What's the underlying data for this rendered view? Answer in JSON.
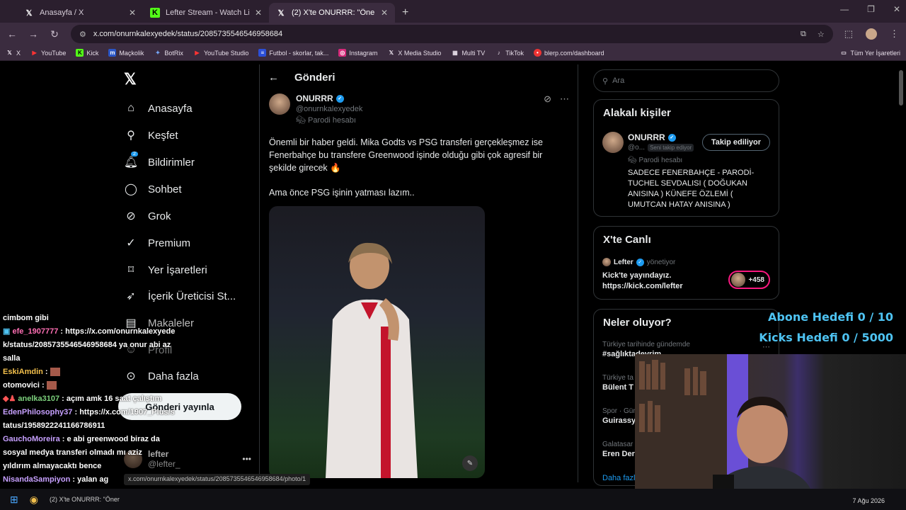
{
  "browser": {
    "tabs": [
      {
        "label": "Anasayfa / X",
        "icon": "x-logo-icon",
        "active": false
      },
      {
        "label": "Lefter Stream - Watch Live on K",
        "icon": "kick-logo-icon",
        "active": false
      },
      {
        "label": "(2) X'te ONURRR: \"Önemli bir ha",
        "icon": "x-logo-icon",
        "active": true
      }
    ],
    "url": "x.com/onurnkalexyedek/status/2085735546546958684",
    "bookmarks": [
      "X",
      "YouTube",
      "Kick",
      "Maçkolik",
      "BotRix",
      "YouTube Studio",
      "Futbol - skorlar, tak...",
      "Instagram",
      "X Media Studio",
      "Multi TV",
      "TikTok",
      "blerp.com/dashboard"
    ],
    "bookmarks_folder": "Tüm Yer İşaretleri"
  },
  "nav": {
    "items": [
      {
        "label": "Anasayfa",
        "icon": "home-icon"
      },
      {
        "label": "Keşfet",
        "icon": "search-icon"
      },
      {
        "label": "Bildirimler",
        "icon": "bell-icon",
        "badge": "2"
      },
      {
        "label": "Sohbet",
        "icon": "chat-icon"
      },
      {
        "label": "Grok",
        "icon": "grok-icon"
      },
      {
        "label": "Premium",
        "icon": "premium-icon"
      },
      {
        "label": "Yer İşaretleri",
        "icon": "bookmark-icon"
      },
      {
        "label": "İçerik Üreticisi St...",
        "icon": "rocket-icon"
      },
      {
        "label": "Makaleler",
        "icon": "article-icon"
      },
      {
        "label": "Profil",
        "icon": "profile-icon"
      },
      {
        "label": "Daha fazla",
        "icon": "more-circle-icon"
      }
    ],
    "post_button": "Gönderi yayınla",
    "account_name": "lefter",
    "account_handle": "@lefter_"
  },
  "post": {
    "header": "Gönderi",
    "author_name": "ONURRR",
    "author_handle": "@onurnkalexyedek",
    "parody": "Parodi hesabı",
    "text1": "Önemli bir haber geldi. Mika Godts vs PSG transferi gerçekleşmez ise Fenerbahçe bu transfere Greenwood işinde olduğu gibi çok agresif bir şekilde girecek 🔥",
    "text2": "Ama önce PSG işinin yatması lazım.."
  },
  "right": {
    "search_placeholder": "Ara",
    "related_title": "Alakalı kişiler",
    "related_name": "ONURRR",
    "related_handle": "@o...",
    "follows_you": "Seni takip ediyor",
    "following_btn": "Takip ediliyor",
    "related_parody": "Parodi hesabı",
    "related_bio": "SADECE FENERBAHÇE - PARODİ- TUCHEL SEVDALISI ( DOĞUKAN ANISINA ) KÜNEFE ÖZLEMİ ( UMUTCAN HATAY ANISINA )",
    "live_title": "X'te Canlı",
    "live_host": "Lefter",
    "live_host_role": "yönetiyor",
    "live_text": "Kick'te yayındayız. https://kick.com/lefter",
    "live_count": "+458",
    "trends_title": "Neler oluyor?",
    "trends": [
      {
        "meta": "Türkiye tarihinde gündemde",
        "name": "#sağlıktadevrim"
      },
      {
        "meta": "Türkiye ta",
        "name": "Bülent T"
      },
      {
        "meta": "Spor · Gün",
        "name": "Guirassy"
      },
      {
        "meta": "Galatasar",
        "name": "Eren Der"
      }
    ],
    "show_more": "Daha fazla"
  },
  "overlay": {
    "goal1": "Abone Hedefi 0 / 10",
    "goal2": "Kicks Hedefi 0 / 5000",
    "chat": [
      {
        "user": "",
        "msg": "cimbom gibi",
        "color": "#ffffff"
      },
      {
        "user": "efe_1907777",
        "msg": "https://x.com/onurnkalexyedek/status/2085735546546958684 ya onur abi az salla",
        "color": "#ff6fb4"
      },
      {
        "user": "EskiAmdin",
        "msg": "",
        "color": "#f3c04c"
      },
      {
        "user": "otomovici",
        "msg": "",
        "color": "#ffffff"
      },
      {
        "user": "anelka3107",
        "msg": "açım amk 16 saat çalıştım",
        "color": "#7cd07c"
      },
      {
        "user": "EdenPhilosophy37",
        "msg": "https://x.com/1907_Plus/status/1958922241166786911",
        "color": "#c7a0ff"
      },
      {
        "user": "GauchoMoreira",
        "msg": "e abi greenwood biraz da sosyal medya transferi olmadı mı aziz yıldırım almayacaktı bence",
        "color": "#c7a0ff"
      },
      {
        "user": "NisandaSampiyon",
        "msg": "yalan ag",
        "color": "#c7a0ff"
      }
    ]
  },
  "status_url": "x.com/onurnkalexyedek/status/2085735546546958684/photo/1",
  "taskbar": {
    "window": "(2) X'te ONURRR: \"Öner",
    "date": "7 Ağu 2026"
  }
}
